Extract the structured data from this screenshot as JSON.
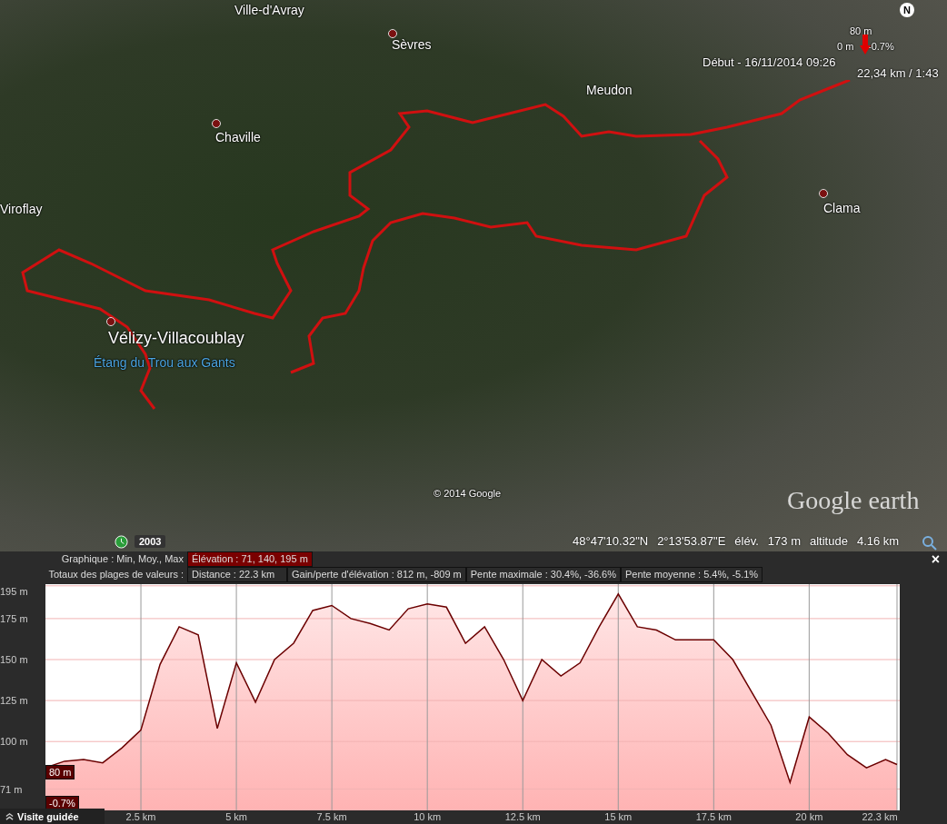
{
  "map": {
    "places": [
      {
        "name": "Ville-d'Avray",
        "kind": "town"
      },
      {
        "name": "Sèvres",
        "kind": "town"
      },
      {
        "name": "Chaville",
        "kind": "town"
      },
      {
        "name": "Viroflay",
        "kind": "town"
      },
      {
        "name": "Meudon",
        "kind": "town"
      },
      {
        "name": "Clama",
        "kind": "town"
      },
      {
        "name": "Vélizy-Villacoublay",
        "kind": "city"
      },
      {
        "name": "Étang du Trou aux Gants",
        "kind": "lake"
      }
    ],
    "start_label": "Début - 16/11/2014 09:26",
    "track_summary": "22,34 km / 1:43",
    "compass": "N",
    "marker": {
      "elevation": "80 m",
      "zero": "0 m",
      "slope": "-0.7%"
    },
    "copyright": "© 2014 Google",
    "logo": "Google earth",
    "imagery_year": "2003",
    "status": [
      {
        "text": "48°47'10.32\"N"
      },
      {
        "text": "2°13'53.87\"E"
      },
      {
        "text": "élév."
      },
      {
        "text": "173 m"
      },
      {
        "text": "altitude"
      },
      {
        "text": "4.16 km"
      }
    ]
  },
  "profile": {
    "graph_row": {
      "label": "Graphique : Min, Moy., Max",
      "values": [
        {
          "text": "Élévation : 71, 140, 195 m",
          "selected": true
        }
      ]
    },
    "totals_row": {
      "label": "Totaux des plages de valeurs :",
      "cells": [
        "Distance : 22.3 km",
        "Gain/perte d'élévation : 812 m, -809 m",
        "Pente maximale : 30.4%, -36.6%",
        "Pente moyenne : 5.4%, -5.1%"
      ]
    },
    "close": "×",
    "marker_elevation": "80 m",
    "marker_slope": "-0.7%",
    "tour_button": "Visite guidée",
    "chart_data": {
      "type": "area",
      "x": [
        0,
        0.5,
        1,
        1.5,
        2,
        2.5,
        3,
        3.5,
        4,
        4.5,
        5,
        5.5,
        6,
        6.5,
        7,
        7.5,
        8,
        8.5,
        9,
        9.5,
        10,
        10.5,
        11,
        11.5,
        12,
        12.5,
        13,
        13.5,
        14,
        14.5,
        15,
        15.5,
        16,
        16.5,
        17,
        17.5,
        18,
        18.5,
        19,
        19.5,
        20,
        20.5,
        21,
        21.5,
        22,
        22.3
      ],
      "series": [
        {
          "color": "#6b0000",
          "values": [
            84,
            88,
            89,
            87,
            96,
            107,
            147,
            170,
            165,
            108,
            148,
            124,
            150,
            160,
            180,
            183,
            175,
            172,
            168,
            181,
            184,
            182,
            160,
            170,
            150,
            125,
            150,
            140,
            148,
            170,
            190,
            170,
            168,
            162,
            162,
            162,
            150,
            130,
            110,
            75,
            115,
            105,
            92,
            84,
            89,
            86
          ]
        }
      ],
      "grid": true,
      "xlim": [
        0,
        22.3
      ],
      "ylim": [
        58,
        196
      ],
      "xticks": [
        {
          "value": 2.5,
          "label": "2.5 km"
        },
        {
          "value": 5,
          "label": "5 km"
        },
        {
          "value": 7.5,
          "label": "7.5 km"
        },
        {
          "value": 10,
          "label": "10 km"
        },
        {
          "value": 12.5,
          "label": "12.5 km"
        },
        {
          "value": 15,
          "label": "15 km"
        },
        {
          "value": 17.5,
          "label": "17.5 km"
        },
        {
          "value": 20,
          "label": "20 km"
        },
        {
          "value": 22.3,
          "label": "22.3 km"
        }
      ],
      "yticks": [
        {
          "value": 71,
          "label": "71 m"
        },
        {
          "value": 100,
          "label": "100 m"
        },
        {
          "value": 125,
          "label": "125 m"
        },
        {
          "value": 150,
          "label": "150 m"
        },
        {
          "value": 175,
          "label": "175 m"
        },
        {
          "value": 195,
          "label": "195 m"
        }
      ]
    }
  }
}
